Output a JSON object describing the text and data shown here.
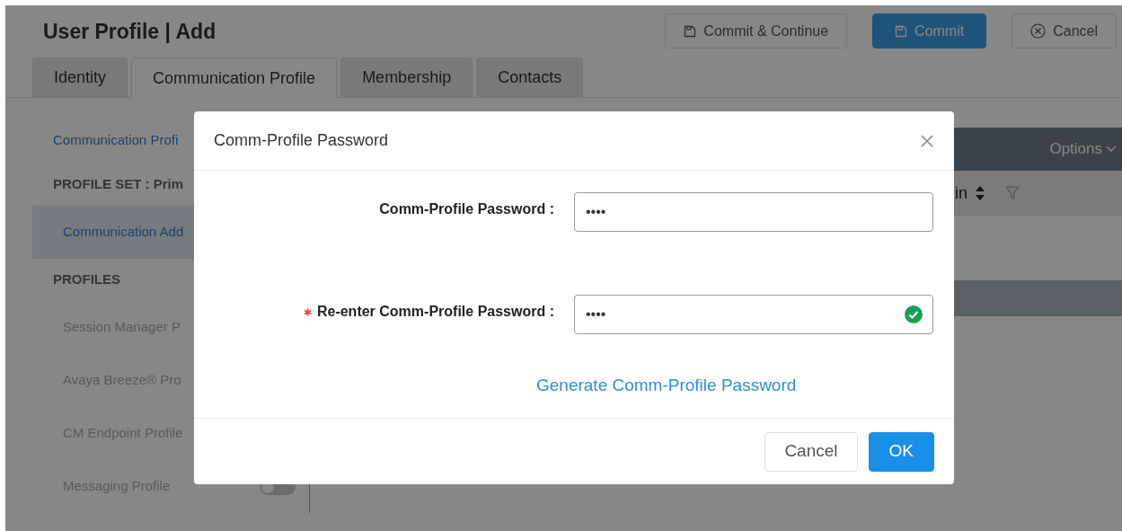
{
  "page": {
    "title": "User Profile | Add"
  },
  "actions": [
    {
      "label": "Commit & Continue",
      "kind": "save"
    },
    {
      "label": "Commit",
      "kind": "primary"
    },
    {
      "label": "Cancel",
      "kind": "cancel"
    }
  ],
  "tabs": [
    {
      "label": "Identity",
      "selected": false
    },
    {
      "label": "Communication Profile",
      "selected": true
    },
    {
      "label": "Membership",
      "selected": false
    },
    {
      "label": "Contacts",
      "selected": false
    }
  ],
  "sidebar": {
    "items": [
      {
        "label": "Communication Profi",
        "kind": "link",
        "selected": false
      },
      {
        "label": "PROFILE SET : Prim",
        "kind": "heading"
      },
      {
        "label": "Communication Add",
        "kind": "link",
        "selected": true
      },
      {
        "label": "PROFILES",
        "kind": "heading"
      },
      {
        "label": "Session Manager P",
        "kind": "profile"
      },
      {
        "label": "Avaya Breeze® Pro",
        "kind": "profile"
      },
      {
        "label": "CM Endpoint Profile",
        "kind": "profile"
      },
      {
        "label": "Messaging Profile",
        "kind": "toggle",
        "on": false
      }
    ]
  },
  "panel": {
    "menu": "Options",
    "column_header": "in"
  },
  "dialog": {
    "title": "Comm-Profile Password",
    "fields": [
      {
        "label": "Comm-Profile Password :",
        "value": "••••",
        "required": false,
        "valid": false
      },
      {
        "label": "Re-enter Comm-Profile Password :",
        "value": "••••",
        "required": true,
        "valid": true
      }
    ],
    "link": "Generate Comm-Profile Password",
    "buttons": [
      {
        "label": "Cancel",
        "kind": "secondary"
      },
      {
        "label": "OK",
        "kind": "primary"
      }
    ]
  }
}
